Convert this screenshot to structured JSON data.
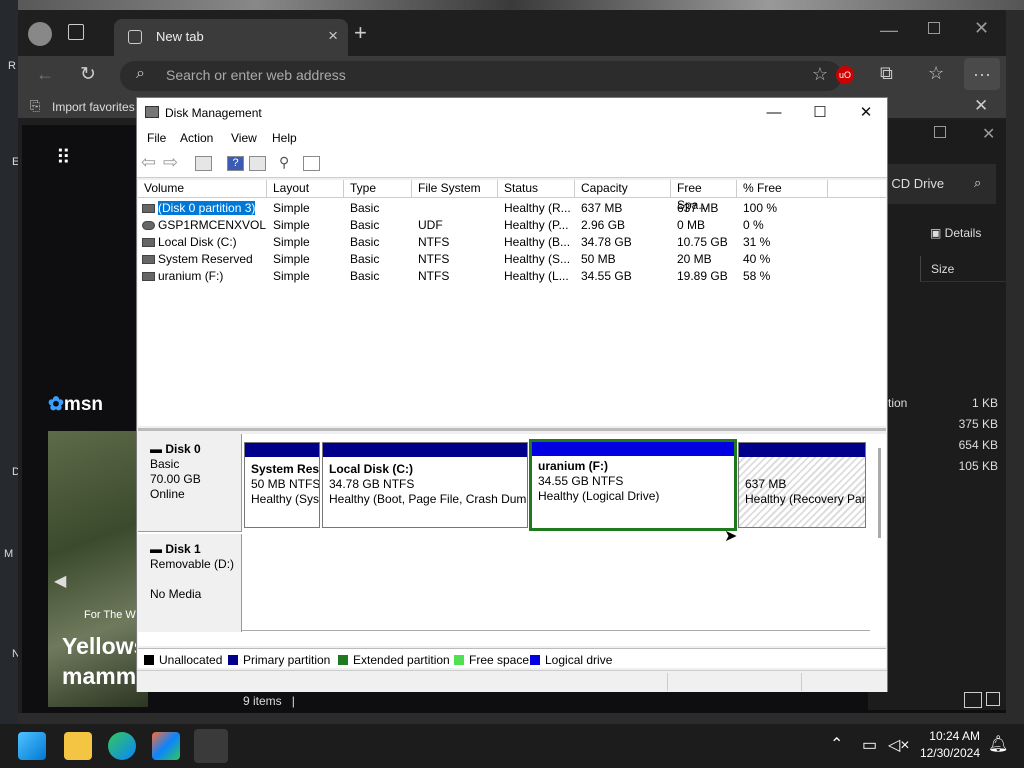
{
  "browser": {
    "tab_title": "New tab",
    "address_placeholder": "Search or enter web address",
    "favorites_label": "Import favorites"
  },
  "ntp": {
    "msn_label": "msn",
    "card_kicker": "For The W",
    "card_headline_1": "Yellows",
    "card_headline_2": "mamm"
  },
  "explorer": {
    "search_text": "ch CD Drive",
    "details_label": "Details",
    "size_header": "Size",
    "partial_label": "tion",
    "sizes": [
      "1 KB",
      "375 KB",
      "654 KB",
      "105 KB"
    ],
    "items_count": "9 items"
  },
  "desktop": {
    "left_letters": [
      "R",
      "E",
      "D",
      "M",
      "N"
    ]
  },
  "dm": {
    "title": "Disk Management",
    "menu": [
      "File",
      "Action",
      "View",
      "Help"
    ],
    "columns": [
      "Volume",
      "Layout",
      "Type",
      "File System",
      "Status",
      "Capacity",
      "Free Spa...",
      "% Free"
    ],
    "rows": [
      {
        "volume": "(Disk 0 partition 3)",
        "layout": "Simple",
        "type": "Basic",
        "fs": "",
        "status": "Healthy (R...",
        "capacity": "637 MB",
        "free": "637 MB",
        "pct": "100 %"
      },
      {
        "volume": "GSP1RMCENXVOL...",
        "layout": "Simple",
        "type": "Basic",
        "fs": "UDF",
        "status": "Healthy (P...",
        "capacity": "2.96 GB",
        "free": "0 MB",
        "pct": "0 %"
      },
      {
        "volume": "Local Disk (C:)",
        "layout": "Simple",
        "type": "Basic",
        "fs": "NTFS",
        "status": "Healthy (B...",
        "capacity": "34.78 GB",
        "free": "10.75 GB",
        "pct": "31 %"
      },
      {
        "volume": "System Reserved",
        "layout": "Simple",
        "type": "Basic",
        "fs": "NTFS",
        "status": "Healthy (S...",
        "capacity": "50 MB",
        "free": "20 MB",
        "pct": "40 %"
      },
      {
        "volume": "uranium (F:)",
        "layout": "Simple",
        "type": "Basic",
        "fs": "NTFS",
        "status": "Healthy (L...",
        "capacity": "34.55 GB",
        "free": "19.89 GB",
        "pct": "58 %"
      }
    ],
    "disk0": {
      "name": "Disk 0",
      "type": "Basic",
      "size": "70.00 GB",
      "state": "Online"
    },
    "disk1": {
      "name": "Disk 1",
      "type": "Removable (D:)",
      "media": "No Media"
    },
    "parts": [
      {
        "name": "System Res",
        "size": "50 MB NTFS",
        "status": "Healthy (Sys"
      },
      {
        "name": "Local Disk  (C:)",
        "size": "34.78 GB NTFS",
        "status": "Healthy (Boot, Page File, Crash Dum"
      },
      {
        "name": "uranium  (F:)",
        "size": "34.55 GB NTFS",
        "status": "Healthy (Logical Drive)"
      },
      {
        "name": "",
        "size": "637 MB",
        "status": "Healthy (Recovery Par"
      }
    ],
    "legend": [
      "Unallocated",
      "Primary partition",
      "Extended partition",
      "Free space",
      "Logical drive"
    ]
  },
  "colors": {
    "primary": "#00008b",
    "logical": "#0000e0",
    "extended": "#1f7a1f",
    "free": "#50e050",
    "unalloc": "#000000"
  },
  "taskbar": {
    "time": "10:24 AM",
    "date": "12/30/2024"
  }
}
